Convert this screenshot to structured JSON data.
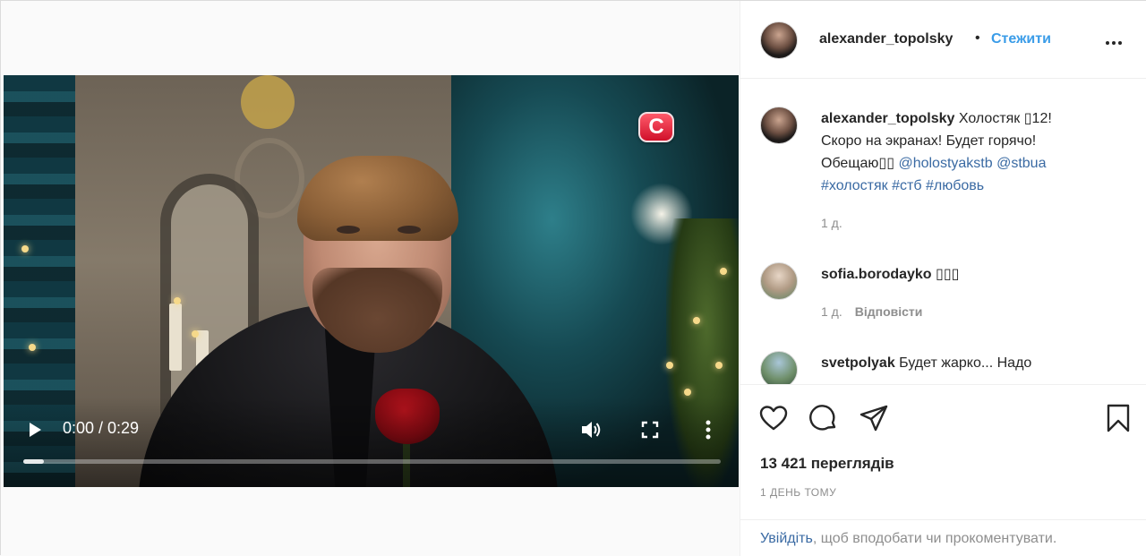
{
  "video": {
    "channel_logo_letter": "С",
    "time": "0:00 / 0:29",
    "progress": 0.03
  },
  "header": {
    "username": "alexander_topolsky",
    "separator": "•",
    "follow_label": "Стежити"
  },
  "caption": {
    "username": "alexander_topolsky",
    "text_line1": "Холостяк ▯12!",
    "text_line2": "Скоро на экранах! Будет горячо!",
    "text_line3_prefix": "Обещаю▯▯ ",
    "mention1": "@holostyakstb",
    "mention2": "@stbua",
    "hashtag1": "#холостяк",
    "hashtag2": "#стб",
    "hashtag3": "#любовь",
    "time": "1 д."
  },
  "comments": [
    {
      "username": "sofia.borodayko",
      "text": "▯▯▯",
      "time": "1 д.",
      "reply_label": "Відповісти"
    },
    {
      "username": "svetpolyak",
      "text": "Будет жарко... Надо"
    }
  ],
  "actions": {
    "views": "13 421 переглядів",
    "posted": "1 ДЕНЬ ТОМУ"
  },
  "login_prompt": {
    "link": "Увійдіть",
    "rest": ", щоб вподобати чи прокоментувати."
  }
}
